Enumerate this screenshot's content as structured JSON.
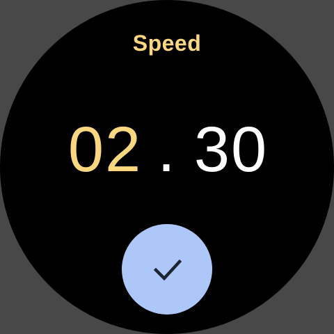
{
  "picker": {
    "title": "Speed",
    "major_value": "02",
    "separator": ".",
    "minor_value": "30",
    "active_color": "#fbd77e",
    "inactive_color": "#ffffff"
  },
  "confirm": {
    "icon": "check-icon",
    "background": "#adc8f8"
  },
  "colors": {
    "outer_background": "#484848",
    "face_background": "#000000"
  }
}
